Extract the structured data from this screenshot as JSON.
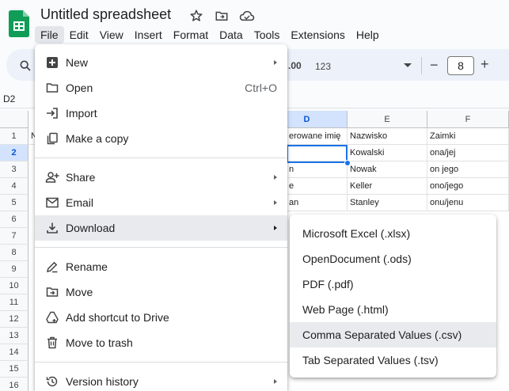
{
  "header": {
    "title": "Untitled spreadsheet",
    "icons": [
      "star-icon",
      "move-to-folder-icon",
      "cloud-status-icon"
    ]
  },
  "menubar": {
    "items": [
      "File",
      "Edit",
      "View",
      "Insert",
      "Format",
      "Data",
      "Tools",
      "Extensions",
      "Help"
    ],
    "active": "File"
  },
  "toolbar": {
    "decimal_label": ".00",
    "format_label": "123",
    "font_size": "8",
    "minus_label": "−",
    "plus_label": "+"
  },
  "namebox": "D2",
  "grid": {
    "columns": [
      "D",
      "E",
      "F"
    ],
    "selected_column": "D",
    "rows": [
      "1",
      "2",
      "3",
      "4",
      "5",
      "6",
      "7",
      "8",
      "9",
      "10",
      "11",
      "12",
      "13",
      "14",
      "15",
      "16"
    ],
    "selected_row": "2",
    "partial_left_cell": "N",
    "cells": [
      [
        "erowane imię",
        "Nazwisko",
        "Zaimki"
      ],
      [
        "",
        "Kowalski",
        "ona/jej"
      ],
      [
        "n",
        "Nowak",
        "on jego"
      ],
      [
        "e",
        "Keller",
        "ono/jego"
      ],
      [
        "an",
        "Stanley",
        "onu/jenu"
      ]
    ]
  },
  "file_menu": {
    "items": [
      {
        "label": "New",
        "icon": "plus-box-icon",
        "submenu": true
      },
      {
        "label": "Open",
        "icon": "folder-icon",
        "shortcut": "Ctrl+O"
      },
      {
        "label": "Import",
        "icon": "import-icon"
      },
      {
        "label": "Make a copy",
        "icon": "copy-icon"
      },
      {
        "label": "Share",
        "icon": "share-person-icon",
        "submenu": true
      },
      {
        "label": "Email",
        "icon": "email-icon",
        "submenu": true
      },
      {
        "label": "Download",
        "icon": "download-icon",
        "submenu": true,
        "highlighted": true
      },
      {
        "label": "Rename",
        "icon": "rename-icon"
      },
      {
        "label": "Move",
        "icon": "move-folder-icon"
      },
      {
        "label": "Add shortcut to Drive",
        "icon": "drive-shortcut-icon"
      },
      {
        "label": "Move to trash",
        "icon": "trash-icon"
      },
      {
        "label": "Version history",
        "icon": "history-icon",
        "submenu": true
      }
    ]
  },
  "download_menu": {
    "items": [
      {
        "label": "Microsoft Excel (.xlsx)"
      },
      {
        "label": "OpenDocument (.ods)"
      },
      {
        "label": "PDF (.pdf)"
      },
      {
        "label": "Web Page (.html)"
      },
      {
        "label": "Comma Separated Values (.csv)",
        "highlighted": true
      },
      {
        "label": "Tab Separated Values (.tsv)"
      }
    ]
  },
  "colors": {
    "accent": "#1a73e8",
    "logo_green": "#0f9d58",
    "selection_header": "#d3e3fd",
    "menu_highlight": "#e8eaed"
  }
}
